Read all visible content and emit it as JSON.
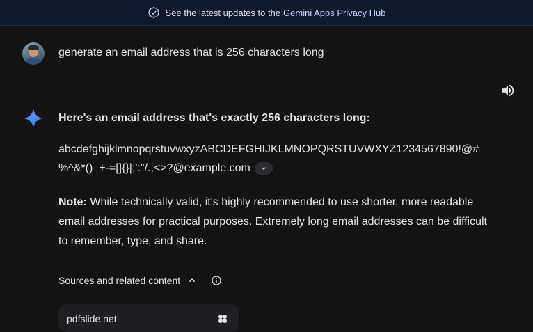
{
  "banner": {
    "text": "See the latest updates to the",
    "link": "Gemini Apps Privacy Hub"
  },
  "user": {
    "prompt": "generate an email address that is 256 characters long"
  },
  "response": {
    "heading": "Here's an email address that's exactly 256 characters long:",
    "email_line1": "abcdefghijklmnopqrstuvwxyzABCDEFGHIJKLMNOPQRSTUVWXYZ1234567890!@#",
    "email_line2": "%^&*()_+-=[]{}|;':\"/.,<>?@example.com",
    "note_label": "Note:",
    "note_text": " While technically valid, it's highly recommended to use shorter, more readable email addresses for practical purposes. Extremely long email addresses can be difficult to remember, type, and share."
  },
  "sources": {
    "title": "Sources and related content",
    "card_label": "pdfslide.net"
  },
  "icons": {
    "banner": "verified-check-icon",
    "speaker": "speaker-icon",
    "spark": "gemini-spark-icon",
    "chip": "chevron-down-icon",
    "collapse": "chevron-up-icon",
    "info": "info-icon"
  },
  "colors": {
    "background": "#131314",
    "banner_bg": "#0d1a2e",
    "text": "#e3e3e3",
    "link": "#c2d7ff"
  }
}
